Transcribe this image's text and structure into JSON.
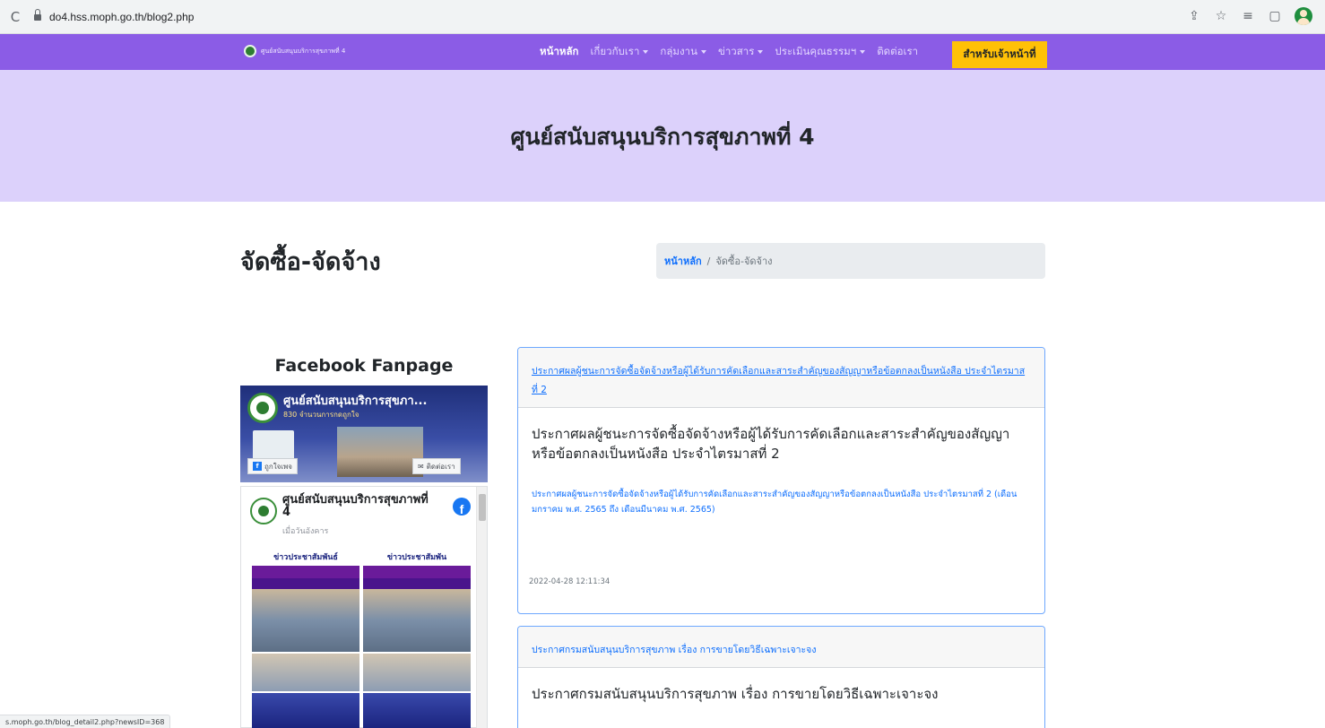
{
  "browser": {
    "url": "do4.hss.moph.go.th/blog2.php",
    "status_url": "s.moph.go.th/blog_detail2.php?newsID=368"
  },
  "navbar": {
    "brand": "ศูนย์สนับสนุนบริการสุขภาพที่ 4",
    "items": [
      {
        "label": "หน้าหลัก",
        "active": true,
        "dropdown": false
      },
      {
        "label": "เกี่ยวกับเรา",
        "active": false,
        "dropdown": true
      },
      {
        "label": "กลุ่มงาน",
        "active": false,
        "dropdown": true
      },
      {
        "label": "ข่าวสาร",
        "active": false,
        "dropdown": true
      },
      {
        "label": "ประเมินคุณธรรมฯ",
        "active": false,
        "dropdown": true
      },
      {
        "label": "ติดต่อเรา",
        "active": false,
        "dropdown": false
      }
    ],
    "staff_button": "สำหรับเจ้าหน้าที่",
    "accent_color": "#8b5ce6",
    "button_color": "#ffc107"
  },
  "hero": {
    "title": "ศูนย์สนับสนุนบริการสุขภาพที่ 4"
  },
  "page": {
    "heading": "จัดซื้อ-จัดจ้าง",
    "breadcrumb": {
      "home": "หน้าหลัก",
      "separator": "/",
      "current": "จัดซื้อ-จัดจ้าง"
    }
  },
  "facebook": {
    "title": "Facebook Fanpage",
    "cover_title": "ศูนย์สนับสนุนบริการสุขภา...",
    "cover_likes": "830 จำนวนการกดถูกใจ",
    "like_button": "ถูกใจเพจ",
    "contact_button": "ติดต่อเรา",
    "page_name": "ศูนย์สนับสนุนบริการสุขภาพที่ 4",
    "page_sub": "เมื่อวันอังคาร",
    "photo_label": "ข่าวประชาสัมพันธ์",
    "photo_label_2": "ข่าวประชาสัมพัน"
  },
  "posts": [
    {
      "header_link": "ประกาศผลผู้ชนะการจัดซื้อจัดจ้างหรือผู้ได้รับการคัดเลือกและสาระสำคัญของสัญญาหรือข้อตกลงเป็นหนังสือ ประจำไตรมาสที่ 2",
      "title": "ประกาศผลผู้ชนะการจัดซื้อจัดจ้างหรือผู้ได้รับการคัดเลือกและสาระสำคัญของสัญญาหรือข้อตกลงเป็นหนังสือ ประจำไตรมาสที่ 2",
      "text": "ประกาศผลผู้ชนะการจัดซื้อจัดจ้างหรือผู้ได้รับการคัดเลือกและสาระสำคัญของสัญญาหรือข้อตกลงเป็นหนังสือ ประจำไตรมาสที่ 2 (เดือนมกราคม พ.ศ. 2565 ถึง เดือนมีนาคม พ.ศ. 2565)",
      "date": "2022-04-28 12:11:34"
    },
    {
      "header_link": "ประกาศกรมสนับสนุนบริการสุขภาพ เรื่อง การขายโดยวิธีเฉพาะเจาะจง",
      "title": "ประกาศกรมสนับสนุนบริการสุขภาพ เรื่อง การขายโดยวิธีเฉพาะเจาะจง"
    }
  ]
}
